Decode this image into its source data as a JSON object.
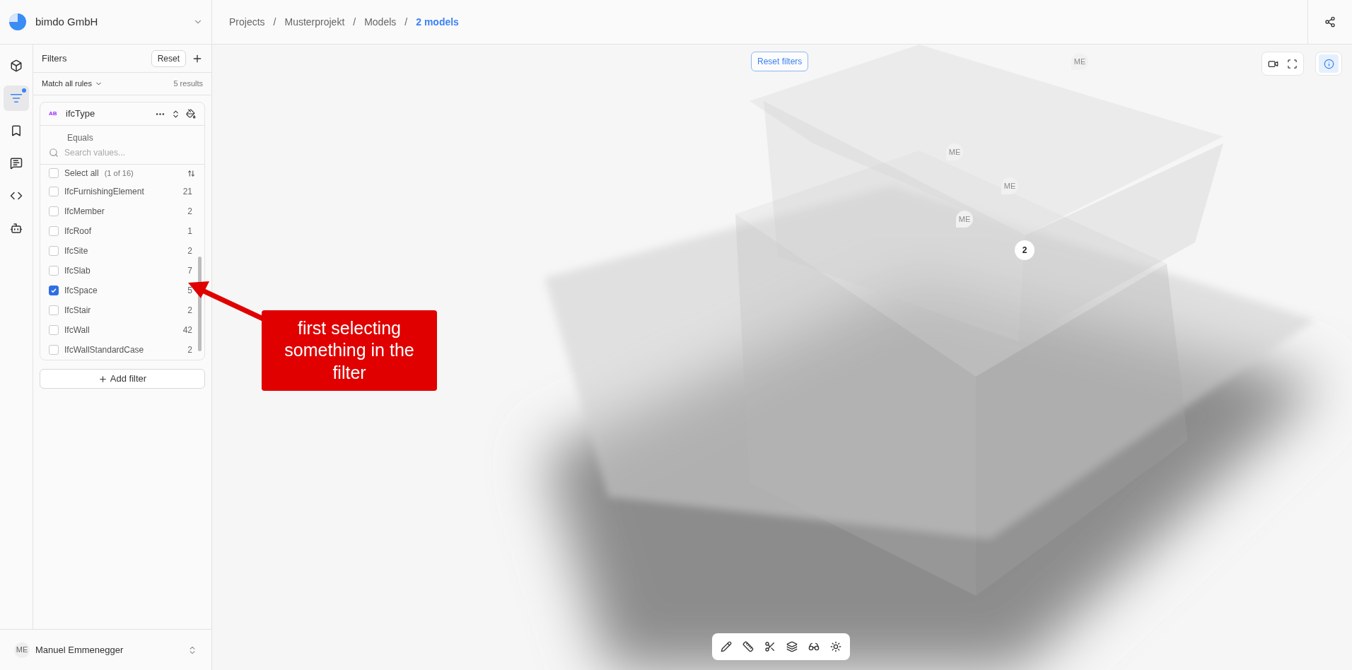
{
  "org": {
    "name": "bimdo GmbH"
  },
  "rail": [
    {
      "selected": false,
      "notification": false
    },
    {
      "selected": true,
      "notification": true
    },
    {
      "selected": false,
      "notification": false
    },
    {
      "selected": false,
      "notification": false
    },
    {
      "selected": false,
      "notification": false
    },
    {
      "selected": false,
      "notification": false
    }
  ],
  "filters": {
    "title": "Filters",
    "reset": "Reset",
    "match": "Match all rules",
    "results": "5 results",
    "rule": {
      "badge": "AB",
      "field": "ifcType",
      "operator": "Equals",
      "search_placeholder": "Search values...",
      "select_all": {
        "label": "Select all",
        "count": "(1 of 16)",
        "checked": false
      },
      "values": [
        {
          "label": "IfcFurnishingElement",
          "count": "21",
          "checked": false
        },
        {
          "label": "IfcMember",
          "count": "2",
          "checked": false
        },
        {
          "label": "IfcRoof",
          "count": "1",
          "checked": false
        },
        {
          "label": "IfcSite",
          "count": "2",
          "checked": false
        },
        {
          "label": "IfcSlab",
          "count": "7",
          "checked": false
        },
        {
          "label": "IfcSpace",
          "count": "5",
          "checked": true
        },
        {
          "label": "IfcStair",
          "count": "2",
          "checked": false
        },
        {
          "label": "IfcWall",
          "count": "42",
          "checked": false
        },
        {
          "label": "IfcWallStandardCase",
          "count": "2",
          "checked": false
        }
      ]
    },
    "add": "Add filter"
  },
  "user": {
    "initials": "ME",
    "name": "Manuel Emmenegger"
  },
  "breadcrumb": [
    {
      "label": "Projects",
      "current": false
    },
    {
      "separator": "/",
      "label": "Musterprojekt",
      "current": false
    },
    {
      "separator": "/",
      "label": "Models",
      "current": false
    },
    {
      "separator": "/",
      "label": "2 models",
      "current": true
    }
  ],
  "viewport": {
    "reset_filters": "Reset filters",
    "info_selected": true,
    "pins": [
      {
        "label": "ME",
        "kind": "comment"
      },
      {
        "label": "ME",
        "kind": "comment"
      },
      {
        "label": "ME",
        "kind": "comment"
      },
      {
        "label": "ME",
        "kind": "comment"
      },
      {
        "label": "2",
        "kind": "cluster"
      }
    ]
  },
  "annotation": {
    "text": "first selecting something in the filter"
  }
}
